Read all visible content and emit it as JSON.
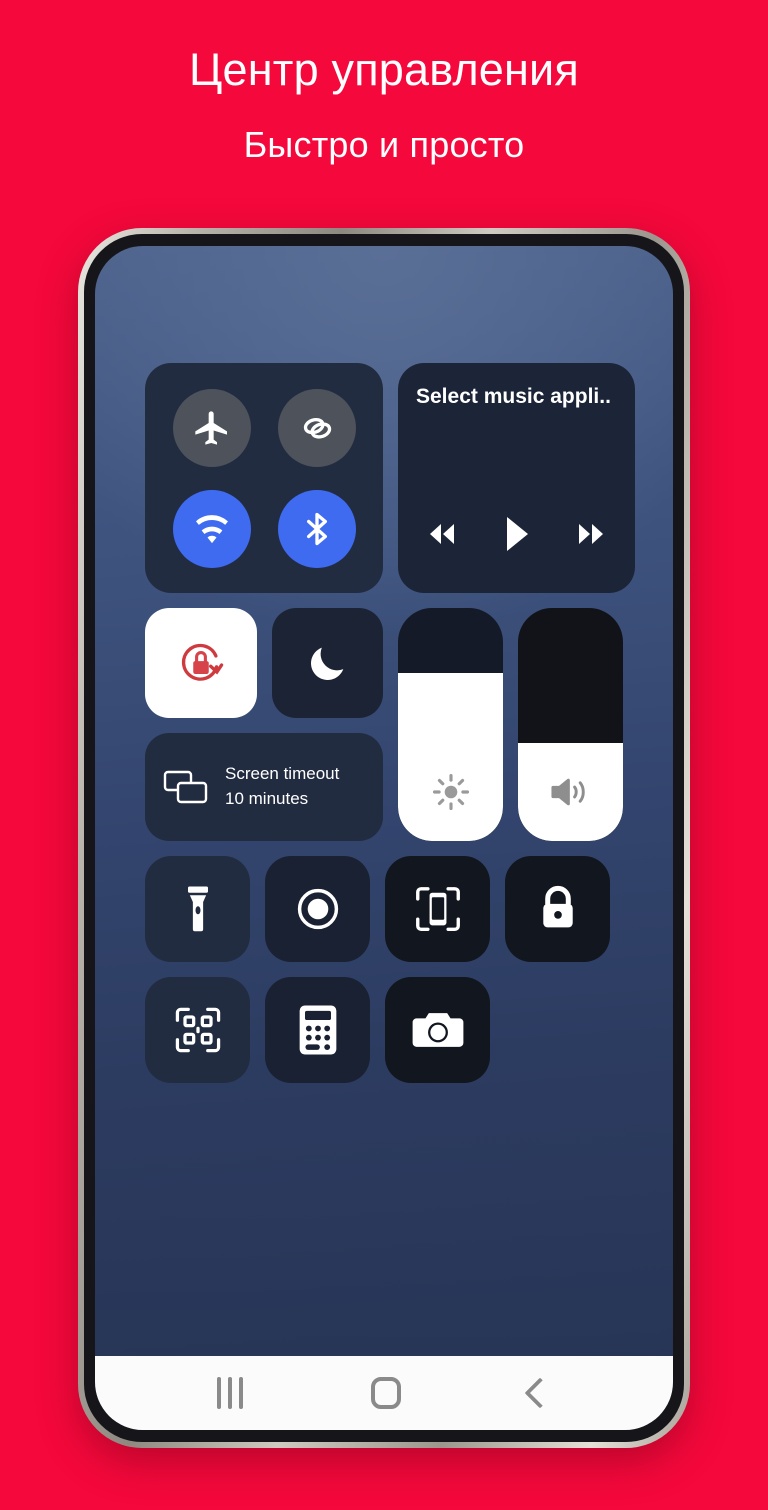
{
  "page": {
    "background_color": "#f5083c",
    "title_main": "Центр управления",
    "title_sub": "Быстро и просто"
  },
  "control_center": {
    "quick_toggles": [
      {
        "name": "airplane-mode",
        "icon": "airplane-icon",
        "state": "off",
        "color": "#4d525b"
      },
      {
        "name": "data-sharing",
        "icon": "link-icon",
        "state": "off",
        "color": "#4d525b"
      },
      {
        "name": "wifi",
        "icon": "wifi-icon",
        "state": "on",
        "color": "#3f6bf0"
      },
      {
        "name": "bluetooth",
        "icon": "bluetooth-icon",
        "state": "on",
        "color": "#3f6bf0"
      }
    ],
    "media": {
      "title": "Select music appli..",
      "buttons": [
        {
          "name": "rewind",
          "icon": "rewind-icon"
        },
        {
          "name": "play",
          "icon": "play-icon"
        },
        {
          "name": "forward",
          "icon": "fast-forward-icon"
        }
      ]
    },
    "rotation_lock": {
      "icon": "rotation-lock-icon",
      "state": "on",
      "icon_color": "#cf3a3f",
      "tile_color": "#ffffff"
    },
    "do_not_disturb": {
      "icon": "moon-icon",
      "state": "off",
      "tile_color": "#1c2335"
    },
    "screen_timeout": {
      "icon": "screen-timeout-icon",
      "label": "Screen timeout",
      "value": "10 minutes"
    },
    "brightness_slider": {
      "icon": "brightness-icon",
      "level_percent": 72
    },
    "volume_slider": {
      "icon": "volume-icon",
      "level_percent": 42
    },
    "shortcuts": [
      {
        "name": "flashlight",
        "icon": "flashlight-icon"
      },
      {
        "name": "screen-record",
        "icon": "record-icon"
      },
      {
        "name": "screenshot",
        "icon": "screenshot-icon"
      },
      {
        "name": "lock-screen",
        "icon": "lock-icon"
      },
      {
        "name": "qr-scanner",
        "icon": "qr-code-icon"
      },
      {
        "name": "calculator",
        "icon": "calculator-icon"
      },
      {
        "name": "camera",
        "icon": "camera-icon"
      }
    ]
  },
  "navigation_bar": {
    "recents_label": "recents-icon",
    "home_label": "home-icon",
    "back_label": "back-icon"
  }
}
